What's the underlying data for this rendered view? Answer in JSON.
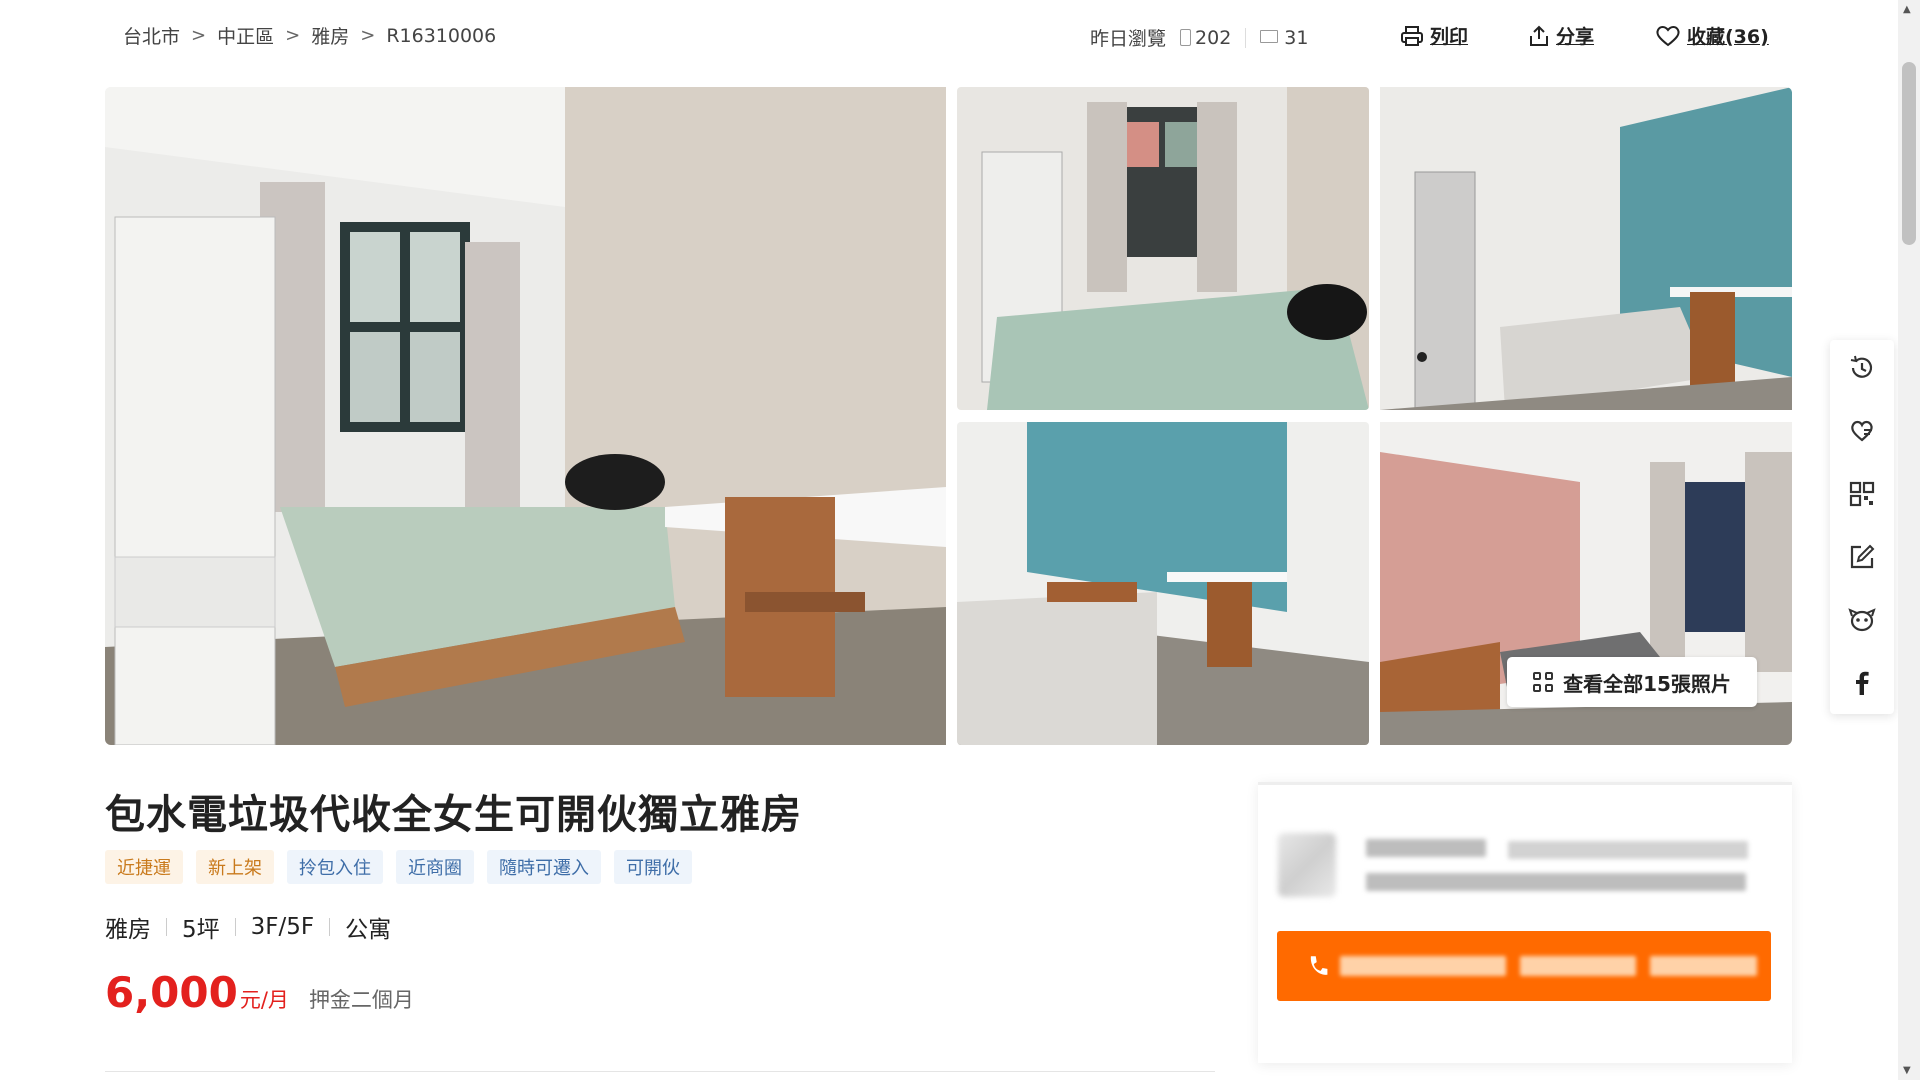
{
  "breadcrumb": {
    "items": [
      "台北市",
      "中正區",
      "雅房",
      "R16310006"
    ],
    "separator": ">"
  },
  "stats": {
    "label": "昨日瀏覽",
    "mobile_views": "202",
    "desktop_views": "31"
  },
  "actions": {
    "print_label": "列印",
    "share_label": "分享",
    "favorite_label": "收藏(36)"
  },
  "gallery": {
    "view_all_label": "查看全部15張照片"
  },
  "listing": {
    "title": "包水電垃圾代收全女生可開伙獨立雅房",
    "tags": [
      {
        "label": "近捷運",
        "style": "orange"
      },
      {
        "label": "新上架",
        "style": "orange"
      },
      {
        "label": "拎包入住",
        "style": "blue"
      },
      {
        "label": "近商圈",
        "style": "blue"
      },
      {
        "label": "隨時可遷入",
        "style": "blue"
      },
      {
        "label": "可開伙",
        "style": "blue"
      }
    ],
    "specs": [
      "雅房",
      "5坪",
      "3F/5F",
      "公寓"
    ],
    "price": "6,000",
    "price_unit": "元/月",
    "deposit": "押金二個月"
  },
  "sidebar_tools": [
    "history-icon",
    "heart-chat-icon",
    "qrcode-icon",
    "edit-icon",
    "pet-icon",
    "facebook-icon"
  ],
  "colors": {
    "price_red": "#e3211e",
    "call_orange": "#ff6a00",
    "tag_orange_text": "#c97a1c",
    "tag_blue_text": "#3f6ea8"
  }
}
